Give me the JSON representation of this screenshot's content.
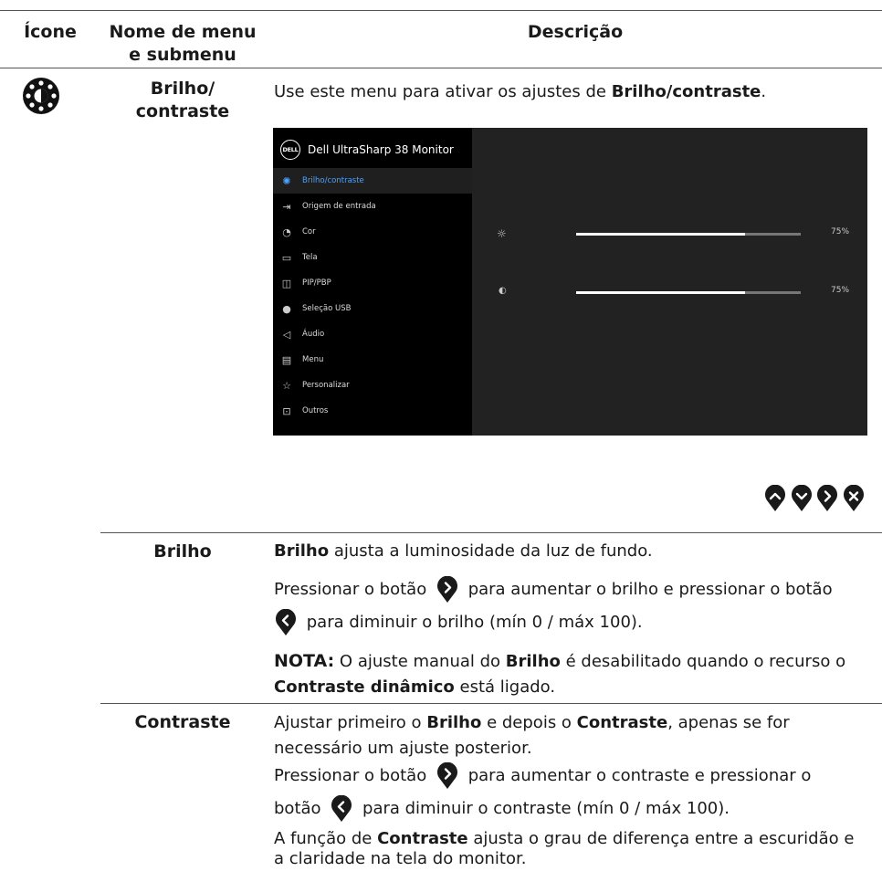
{
  "headers": {
    "icon": "Ícone",
    "menu_line1": "Nome de menu",
    "menu_line2": "e submenu",
    "description": "Descrição"
  },
  "section_icon": "brightness-contrast-icon",
  "menu_name_line1": "Brilho/",
  "menu_name_line2": "contraste",
  "intro": {
    "pre": "Use este menu para ativar os ajustes de ",
    "bold": "Brilho/contraste",
    "post": "."
  },
  "osd": {
    "title": "Dell UltraSharp 38 Monitor",
    "logo": "DELL",
    "items": [
      {
        "label": "Brilho/contraste",
        "icon": "sun-icon",
        "selected": true
      },
      {
        "label": "Origem de entrada",
        "icon": "input-source-icon"
      },
      {
        "label": "Cor",
        "icon": "color-palette-icon"
      },
      {
        "label": "Tela",
        "icon": "display-icon"
      },
      {
        "label": "PIP/PBP",
        "icon": "pip-icon"
      },
      {
        "label": "Seleção USB",
        "icon": "mouse-icon"
      },
      {
        "label": "Áudio",
        "icon": "speaker-icon"
      },
      {
        "label": "Menu",
        "icon": "menu-icon"
      },
      {
        "label": "Personalizar",
        "icon": "star-icon"
      },
      {
        "label": "Outros",
        "icon": "info-icon"
      }
    ],
    "brightness": {
      "icon": "sun-icon",
      "value": 0.75,
      "label": "75%"
    },
    "contrast": {
      "icon": "contrast-icon",
      "value": 0.75,
      "label": "75%"
    }
  },
  "nav_buttons": [
    "up-icon",
    "down-icon",
    "right-icon",
    "close-icon"
  ],
  "brilho": {
    "name": "Brilho",
    "p1_bold": "Brilho",
    "p1_rest": " ajusta a luminosidade da luz de fundo.",
    "p2_a": "Pressionar o botão",
    "p2_b": "para aumentar o brilho e pressionar o botão",
    "p2_c": "para diminuir o brilho (mín 0 / máx 100).",
    "note_label": "NOTA:",
    "note_a": " O ajuste manual do ",
    "note_b": "Brilho",
    "note_c": " é desabilitado quando o recurso o",
    "note_d": "Contraste dinâmico",
    "note_e": " está ligado."
  },
  "contraste": {
    "name": "Contraste",
    "p1_a": "Ajustar primeiro o ",
    "p1_b": "Brilho",
    "p1_c": " e depois o ",
    "p1_d": "Contraste",
    "p1_e": ", apenas se for",
    "p1_f": "necessário um ajuste posterior.",
    "p2_a": "Pressionar o botão",
    "p2_b": "para aumentar o contraste e pressionar o",
    "p2_c": "botão",
    "p2_d": "para diminuir o contraste (mín 0 / máx 100).",
    "p3_a": "A função de ",
    "p3_b": "Contraste",
    "p3_c": " ajusta o grau de diferença entre a escuridão e",
    "p3_d": "a claridade na tela do monitor."
  }
}
